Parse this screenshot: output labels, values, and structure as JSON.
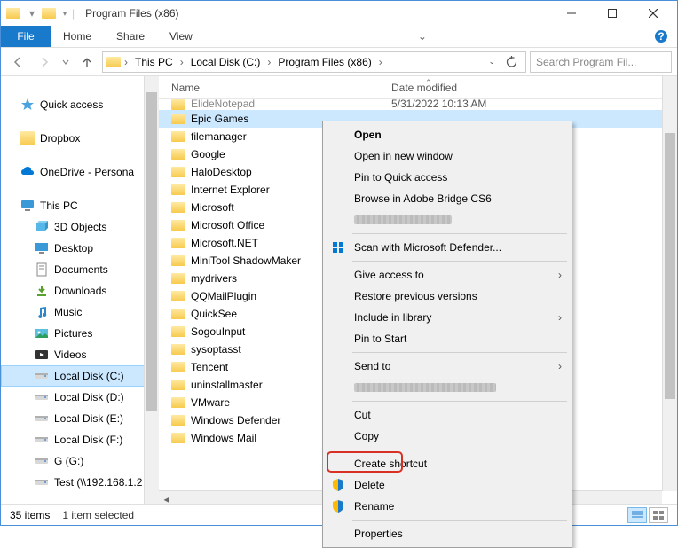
{
  "window": {
    "title": "Program Files (x86)"
  },
  "ribbon": {
    "file": "File",
    "home": "Home",
    "share": "Share",
    "view": "View"
  },
  "breadcrumb": {
    "segments": [
      "This PC",
      "Local Disk (C:)",
      "Program Files (x86)"
    ],
    "search_placeholder": "Search Program Fil..."
  },
  "columns": {
    "name": "Name",
    "date": "Date modified"
  },
  "nav": {
    "quick_access": "Quick access",
    "dropbox": "Dropbox",
    "onedrive": "OneDrive - Persona",
    "this_pc": "This PC",
    "items": [
      "3D Objects",
      "Desktop",
      "Documents",
      "Downloads",
      "Music",
      "Pictures",
      "Videos",
      "Local Disk (C:)",
      "Local Disk (D:)",
      "Local Disk (E:)",
      "Local Disk (F:)",
      "G (G:)",
      "Test (\\\\192.168.1.2"
    ]
  },
  "files": {
    "cutoff": {
      "name": "ElideNotepad",
      "date": "5/31/2022 10:13 AM"
    },
    "list": [
      "Epic Games",
      "filemanager",
      "Google",
      "HaloDesktop",
      "Internet Explorer",
      "Microsoft",
      "Microsoft Office",
      "Microsoft.NET",
      "MiniTool ShadowMaker",
      "mydrivers",
      "QQMailPlugin",
      "QuickSee",
      "SogouInput",
      "sysoptasst",
      "Tencent",
      "uninstallmaster",
      "VMware",
      "Windows Defender",
      "Windows Mail"
    ],
    "selected": "Epic Games"
  },
  "context_menu": {
    "open": "Open",
    "open_new": "Open in new window",
    "pin_qa": "Pin to Quick access",
    "browse_bridge": "Browse in Adobe Bridge CS6",
    "scan": "Scan with Microsoft Defender...",
    "give_access": "Give access to",
    "restore": "Restore previous versions",
    "include_lib": "Include in library",
    "pin_start": "Pin to Start",
    "send_to": "Send to",
    "cut": "Cut",
    "copy": "Copy",
    "create_shortcut": "Create shortcut",
    "delete": "Delete",
    "rename": "Rename",
    "properties": "Properties"
  },
  "status": {
    "count": "35 items",
    "selected": "1 item selected"
  }
}
